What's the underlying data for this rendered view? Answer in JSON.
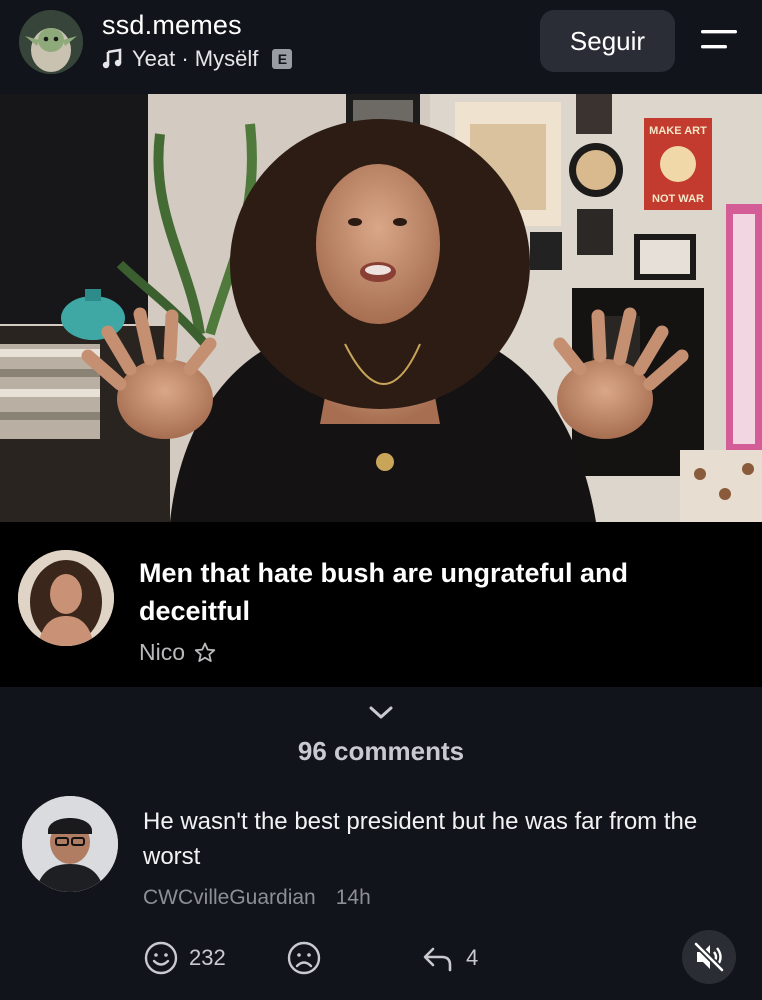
{
  "header": {
    "username": "ssd.memes",
    "song": "Yeat · Mysëlf",
    "explicit_badge": "E",
    "follow_label": "Seguir"
  },
  "caption": {
    "text": "Men that hate bush are ungrateful and deceitful",
    "author": "Nico"
  },
  "comments": {
    "count_label": "96 comments",
    "items": [
      {
        "text": "He wasn't the best president but he was far from the worst",
        "author": "CWCvilleGuardian",
        "time": "14h",
        "likes": "232",
        "replies": "4"
      }
    ]
  },
  "video_wall_art": {
    "poster_text": "MAKE ART NOT WAR"
  },
  "colors": {
    "background": "#12141b",
    "caption_bg": "#000000",
    "button_bg": "#2a2d36",
    "muted_text": "#8d8f97"
  },
  "icons": [
    "music-note-icon",
    "explicit-badge",
    "menu-icon",
    "chevron-down-icon",
    "smile-icon",
    "frown-icon",
    "reply-icon",
    "mute-icon",
    "star-icon"
  ]
}
